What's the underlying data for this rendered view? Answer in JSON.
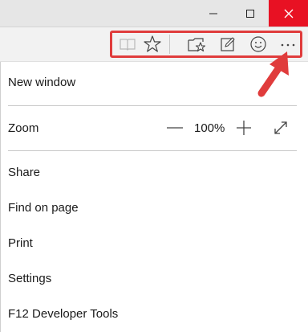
{
  "accent": {
    "close": "#e81123",
    "annotation": "#e03c3c"
  },
  "window": {
    "icons": [
      "minimize-icon",
      "maximize-icon",
      "close-icon"
    ]
  },
  "toolbar": {
    "icons": [
      "reading-view-icon",
      "favorites-star-icon",
      "hub-icon",
      "web-note-icon",
      "send-feedback-smiley-icon",
      "more-actions-icon"
    ],
    "more_label": "···"
  },
  "menu": {
    "new_window": "New window",
    "zoom_label": "Zoom",
    "zoom_value": "100%",
    "share": "Share",
    "find_on_page": "Find on page",
    "print": "Print",
    "settings": "Settings",
    "dev_tools": "F12 Developer Tools"
  }
}
